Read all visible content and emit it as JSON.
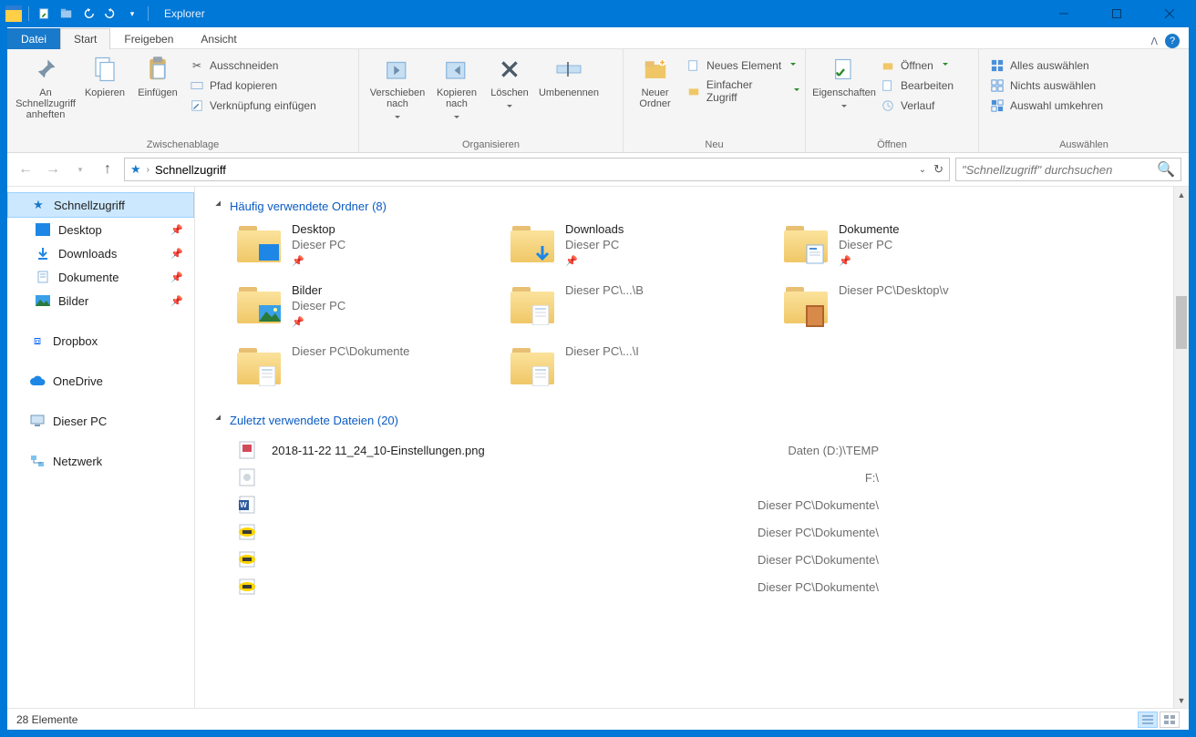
{
  "window": {
    "title": "Explorer"
  },
  "tabs": {
    "file": "Datei",
    "start": "Start",
    "share": "Freigeben",
    "view": "Ansicht"
  },
  "ribbon": {
    "clipboard": {
      "label": "Zwischenablage",
      "pin": "An Schnellzugriff anheften",
      "copy": "Kopieren",
      "paste": "Einfügen",
      "cut": "Ausschneiden",
      "copy_path": "Pfad kopieren",
      "paste_shortcut": "Verknüpfung einfügen"
    },
    "organize": {
      "label": "Organisieren",
      "move_to": "Verschieben nach",
      "copy_to": "Kopieren nach",
      "delete": "Löschen",
      "rename": "Umbenennen"
    },
    "new": {
      "label": "Neu",
      "new_folder": "Neuer Ordner",
      "new_item": "Neues Element",
      "easy_access": "Einfacher Zugriff"
    },
    "open": {
      "label": "Öffnen",
      "properties": "Eigenschaften",
      "open": "Öffnen",
      "edit": "Bearbeiten",
      "history": "Verlauf"
    },
    "select": {
      "label": "Auswählen",
      "select_all": "Alles auswählen",
      "select_none": "Nichts auswählen",
      "invert": "Auswahl umkehren"
    }
  },
  "address": {
    "crumb": "Schnellzugriff"
  },
  "search": {
    "placeholder": "\"Schnellzugriff\" durchsuchen"
  },
  "sidebar": {
    "quick_access": "Schnellzugriff",
    "desktop": "Desktop",
    "downloads": "Downloads",
    "documents": "Dokumente",
    "pictures": "Bilder",
    "dropbox": "Dropbox",
    "onedrive": "OneDrive",
    "this_pc": "Dieser PC",
    "network": "Netzwerk"
  },
  "sections": {
    "frequent": "Häufig verwendete Ordner (8)",
    "recent": "Zuletzt verwendete Dateien (20)"
  },
  "folders": [
    {
      "name": "Desktop",
      "sub": "Dieser PC",
      "pinned": true,
      "overlay": "desktop"
    },
    {
      "name": "Downloads",
      "sub": "Dieser PC",
      "pinned": true,
      "overlay": "download"
    },
    {
      "name": "Dokumente",
      "sub": "Dieser PC",
      "pinned": true,
      "overlay": "doc"
    },
    {
      "name": "Bilder",
      "sub": "Dieser PC",
      "pinned": true,
      "overlay": "pic"
    },
    {
      "name": "",
      "sub": "Dieser PC\\...\\B",
      "pinned": false,
      "overlay": "sheet"
    },
    {
      "name": "",
      "sub": "Dieser PC\\Desktop\\v",
      "pinned": false,
      "overlay": "photo"
    },
    {
      "name": "",
      "sub": "Dieser PC\\Dokumente",
      "pinned": false,
      "overlay": "sheet"
    },
    {
      "name": "",
      "sub": "Dieser PC\\...\\I",
      "pinned": false,
      "overlay": "sheet"
    }
  ],
  "files": [
    {
      "name": "2018-11-22 11_24_10-Einstellungen.png",
      "path": "Daten (D:)\\TEMP",
      "icon": "png"
    },
    {
      "name": "",
      "path": "F:\\",
      "icon": "generic"
    },
    {
      "name": "",
      "path": "Dieser PC\\Dokumente\\",
      "icon": "word"
    },
    {
      "name": "",
      "path": "Dieser PC\\Dokumente\\",
      "icon": "pub"
    },
    {
      "name": "",
      "path": "Dieser PC\\Dokumente\\",
      "icon": "pub"
    },
    {
      "name": "",
      "path": "Dieser PC\\Dokumente\\",
      "icon": "pub"
    }
  ],
  "status": {
    "items": "28 Elemente"
  }
}
